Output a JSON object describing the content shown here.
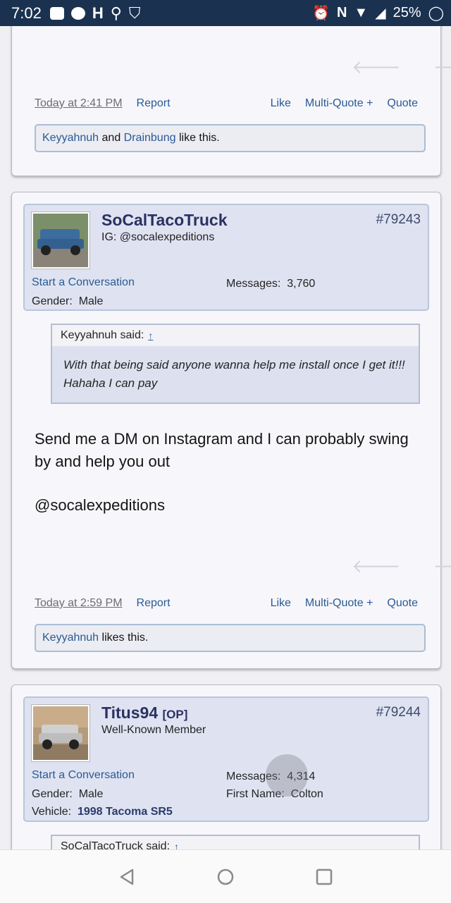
{
  "status_bar": {
    "time": "7:02",
    "battery": "25%"
  },
  "post1": {
    "date": "Today at 2:41 PM",
    "report": "Report",
    "like": "Like",
    "multiquote": "Multi-Quote +",
    "quote": "Quote",
    "likes": {
      "user1": "Keyyahnuh",
      "and": "and",
      "user2": "Drainbung",
      "suffix": "like this."
    }
  },
  "post2": {
    "username": "SoCalTacoTruck",
    "user_title": "IG: @socalexpeditions",
    "post_number": "#79243",
    "start_conversation": "Start a Conversation",
    "messages_label": "Messages:",
    "messages_value": "3,760",
    "gender_label": "Gender:",
    "gender_value": "Male",
    "quote": {
      "author": "Keyyahnuh said:",
      "arrow": "↑",
      "text": "With that being said anyone wanna help me install once I get it!!! Hahaha I can pay"
    },
    "body_line1": "Send me a DM on Instagram and I can probably swing by and help you out",
    "body_line2": "@socalexpeditions",
    "date": "Today at 2:59 PM",
    "report": "Report",
    "like": "Like",
    "multiquote": "Multi-Quote +",
    "quote_btn": "Quote",
    "likes": {
      "user1": "Keyyahnuh",
      "suffix": "likes this."
    }
  },
  "post3": {
    "username": "Titus94",
    "op_badge": "[OP]",
    "user_title": "Well-Known Member",
    "post_number": "#79244",
    "start_conversation": "Start a Conversation",
    "messages_label": "Messages:",
    "messages_value": "4,314",
    "gender_label": "Gender:",
    "gender_value": "Male",
    "firstname_label": "First Name:",
    "firstname_value": "Colton",
    "vehicle_label": "Vehicle:",
    "vehicle_value": "1998 Tacoma SR5",
    "quote_author": "SoCalTacoTruck said:",
    "quote_arrow": "↑"
  },
  "colors": {
    "status_bar": "#1b3150",
    "link": "#2a5a94",
    "username": "#2b3163"
  }
}
